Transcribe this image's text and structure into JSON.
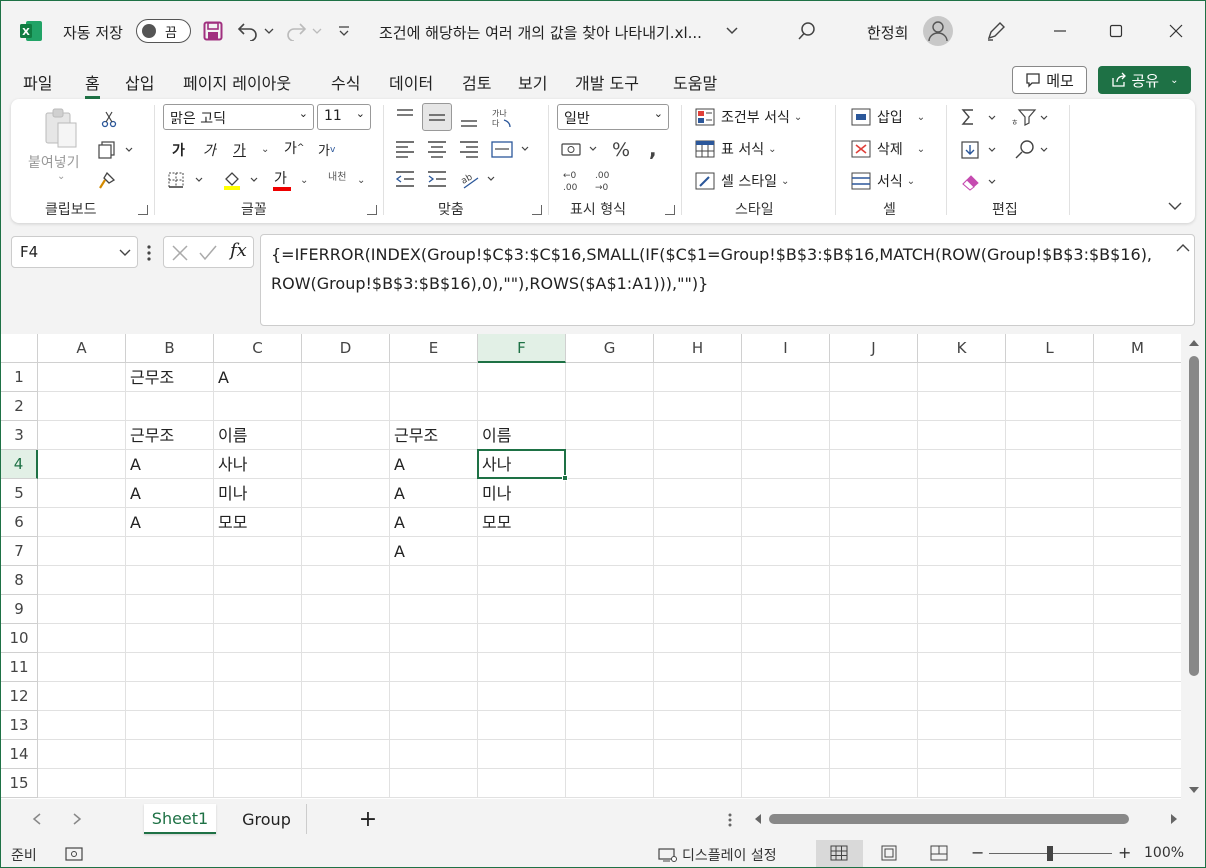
{
  "titlebar": {
    "autosave_label": "자동 저장",
    "autosave_state": "끔",
    "filename": "조건에 해당하는 여러 개의 값을 찾아 나타내기.xl...",
    "user_name": "한정희"
  },
  "menu": {
    "tabs": [
      "파일",
      "홈",
      "삽입",
      "페이지 레이아웃",
      "수식",
      "데이터",
      "검토",
      "보기",
      "개발 도구",
      "도움말"
    ],
    "active_tab": "홈",
    "memo_label": "메모",
    "share_label": "공유"
  },
  "ribbon": {
    "clipboard": {
      "paste_label": "붙여넣기",
      "group_label": "클립보드"
    },
    "font": {
      "font_name": "맑은 고딕",
      "font_size": "11",
      "group_label": "글꼴",
      "bold": "가",
      "italic": "가",
      "underline": "가",
      "grow": "가",
      "shrink": "가",
      "color": "가",
      "phonetic": "내천"
    },
    "alignment": {
      "group_label": "맞춤",
      "wrap": "가나다"
    },
    "number": {
      "format": "일반",
      "group_label": "표시 형식"
    },
    "styles": {
      "conditional": "조건부 서식",
      "table": "표 서식",
      "cell_styles": "셀 스타일",
      "group_label": "스타일"
    },
    "cells": {
      "insert": "삽입",
      "delete": "삭제",
      "format": "서식",
      "group_label": "셀"
    },
    "editing": {
      "group_label": "편집"
    }
  },
  "formula_bar": {
    "name_box": "F4",
    "formula": "{=IFERROR(INDEX(Group!$C$3:$C$16,SMALL(IF($C$1=Group!$B$3:$B$16,MATCH(ROW(Group!$B$3:$B$16),\nROW(Group!$B$3:$B$16),0),\"\"),ROWS($A$1:A1))),\"\")}"
  },
  "sheet": {
    "columns": [
      "A",
      "B",
      "C",
      "D",
      "E",
      "F",
      "G",
      "H",
      "I",
      "J",
      "K",
      "L",
      "M"
    ],
    "rows": [
      "1",
      "2",
      "3",
      "4",
      "5",
      "6",
      "7",
      "8",
      "9",
      "10",
      "11",
      "12",
      "13",
      "14",
      "15"
    ],
    "selected_col": "F",
    "selected_row": "4",
    "cells": {
      "B1": "근무조",
      "C1": "A",
      "B3": "근무조",
      "C3": "이름",
      "E3": "근무조",
      "F3": "이름",
      "B4": "A",
      "C4": "사나",
      "E4": "A",
      "F4": "사나",
      "B5": "A",
      "C5": "미나",
      "E5": "A",
      "F5": "미나",
      "B6": "A",
      "C6": "모모",
      "E6": "A",
      "F6": "모모",
      "E7": "A"
    }
  },
  "sheet_tabs": {
    "tabs": [
      "Sheet1",
      "Group"
    ],
    "active": "Sheet1",
    "add": "+"
  },
  "statusbar": {
    "ready": "준비",
    "display_settings": "디스플레이 설정",
    "zoom": "100%",
    "zoom_minus": "−",
    "zoom_plus": "+"
  },
  "colors": {
    "accent": "#1e7145",
    "frame": "#1e7145"
  }
}
